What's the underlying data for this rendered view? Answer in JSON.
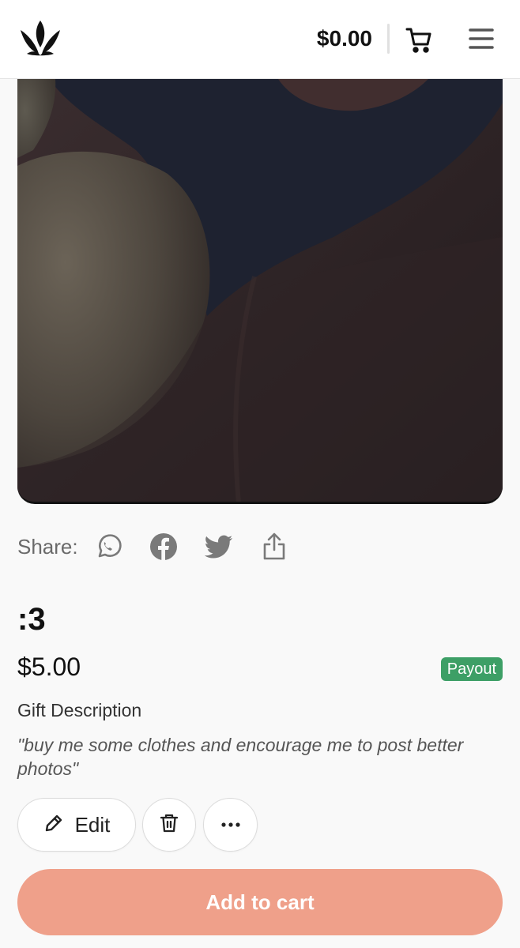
{
  "header": {
    "balance": "$0.00",
    "logo_icon": "crown-logo-icon",
    "cart_icon": "cart-icon",
    "menu_icon": "hamburger-menu-icon"
  },
  "share": {
    "label": "Share:",
    "icons": [
      "whatsapp-icon",
      "facebook-icon",
      "twitter-icon",
      "share-upload-icon"
    ]
  },
  "product": {
    "title": ":3",
    "price": "$5.00",
    "badge": "Payout",
    "description_heading": "Gift Description",
    "description": "\"buy me some clothes and encourage me to post better photos\""
  },
  "actions": {
    "edit_label": "Edit",
    "delete_icon": "trash-icon",
    "more_icon": "more-dots-icon"
  },
  "cta": {
    "add_to_cart": "Add to cart"
  },
  "colors": {
    "accent": "#efa08a",
    "badge": "#3d9f66",
    "icon_gray": "#7a7a7a"
  }
}
